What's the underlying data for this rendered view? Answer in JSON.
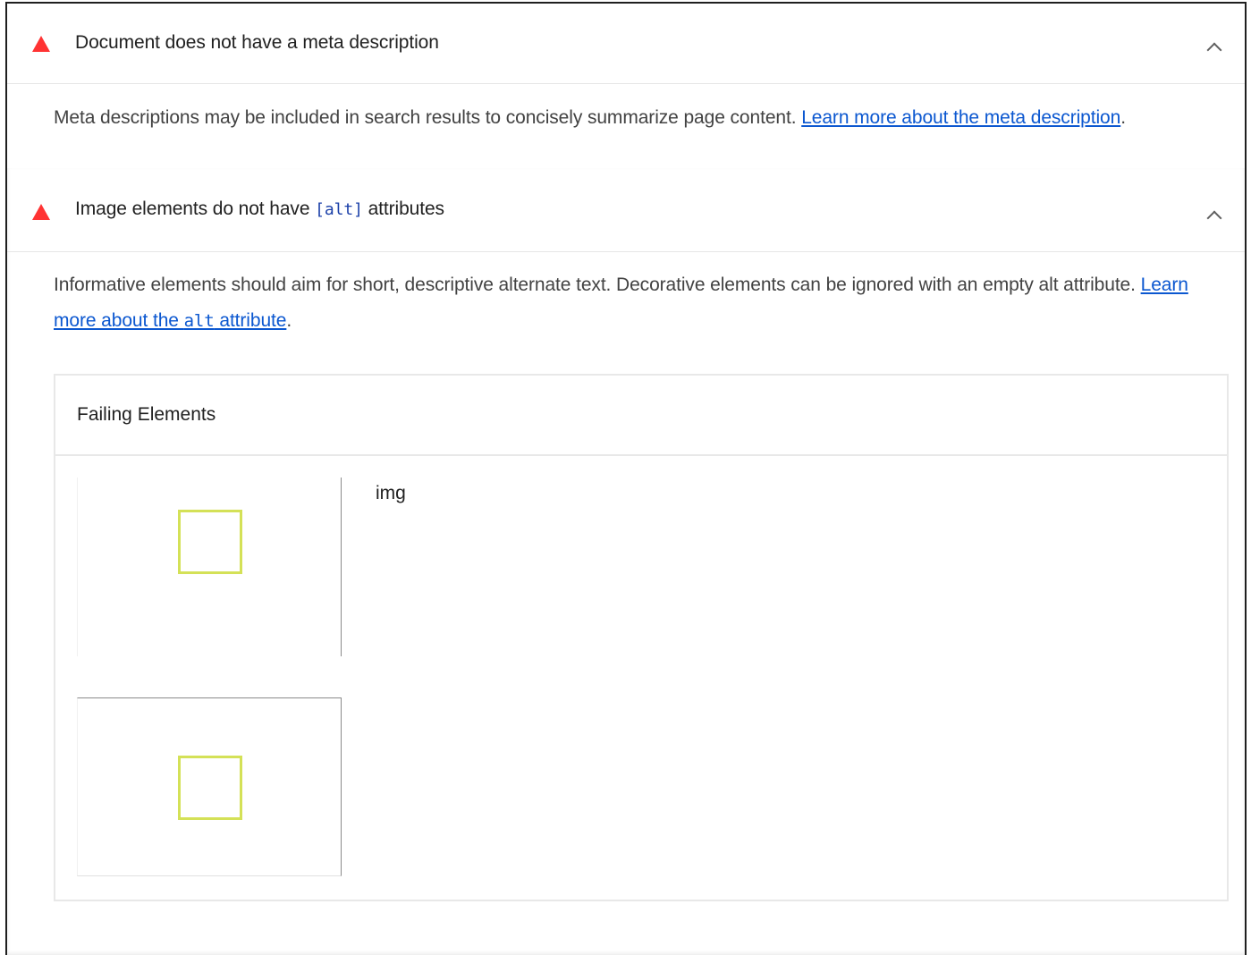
{
  "audits": [
    {
      "title": "Document does not have a meta description",
      "description": "Meta descriptions may be included in search results to concisely summarize page content. ",
      "link_text": "Learn more about the meta description",
      "trailing": ".",
      "status_color": "#ff3333",
      "icon": "fail-triangle-icon",
      "expand_icon": "chevron-up-icon"
    },
    {
      "title_before": "Image elements do not have ",
      "title_code": "[alt]",
      "title_after": " attributes",
      "description": "Informative elements should aim for short, descriptive alternate text. Decorative elements can be ignored with an empty alt attribute. ",
      "link_text_before": "Learn more about the ",
      "link_code": "alt",
      "link_text_after": " attribute",
      "trailing": ".",
      "status_color": "#ff3333",
      "icon": "fail-triangle-icon",
      "expand_icon": "chevron-up-icon",
      "details": {
        "header": "Failing Elements",
        "items": [
          {
            "node": "img",
            "thumbnail_icon": "image-placeholder-icon",
            "accent": "#d4e157"
          },
          {
            "node": "",
            "thumbnail_icon": "image-placeholder-icon",
            "accent": "#d4e157"
          }
        ]
      }
    }
  ],
  "colors": {
    "link": "#0b57d0",
    "code": "#1a3fa8",
    "fail": "#ff3333"
  }
}
